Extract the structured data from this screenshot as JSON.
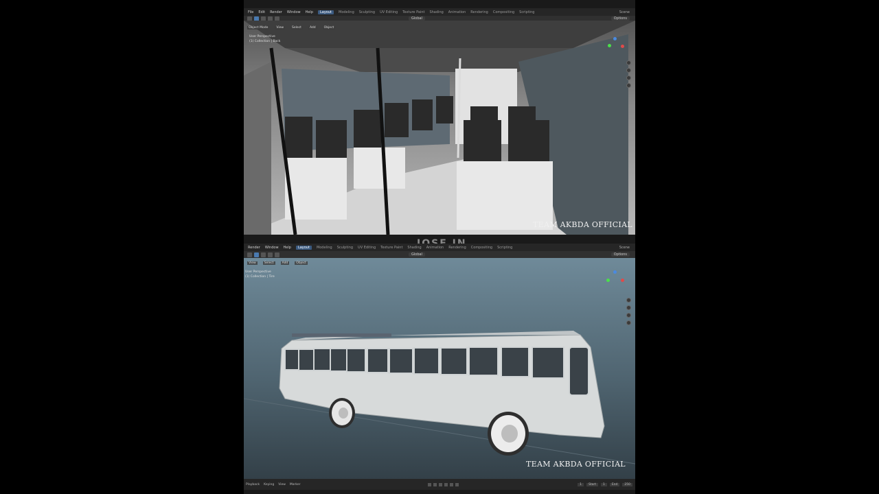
{
  "top_window": {
    "menu": [
      "File",
      "Edit",
      "Render",
      "Window",
      "Help"
    ],
    "workspaces": [
      "Layout",
      "Modeling",
      "Sculpting",
      "UV Editing",
      "Texture Paint",
      "Shading",
      "Animation",
      "Rendering",
      "Compositing",
      "Scripting"
    ],
    "active_workspace": "Layout",
    "scene": "Scene",
    "transform_orientation": "Global",
    "options": "Options",
    "header_menus": [
      "Object Mode",
      "View",
      "Select",
      "Add",
      "Object"
    ],
    "view_info": [
      "User Perspective",
      "(1) Collection | Back"
    ],
    "watermark": "TEAM AKBDA OFFICIAL"
  },
  "bottom_window": {
    "menu": [
      "Render",
      "Window",
      "Help"
    ],
    "workspaces": [
      "Layout",
      "Modeling",
      "Sculpting",
      "UV Editing",
      "Texture Paint",
      "Shading",
      "Animation",
      "Rendering",
      "Compositing",
      "Scripting"
    ],
    "active_workspace": "Layout",
    "scene": "Scene",
    "transform_orientation": "Global",
    "options": "Options",
    "header_menus": [
      "View",
      "Select",
      "Add",
      "Object"
    ],
    "view_info": [
      "User Perspective",
      "(1) Collection | Tire"
    ],
    "watermark": "TEAM AKBDA OFFICIAL",
    "timeline": {
      "left": [
        "Playback",
        "Keying",
        "View",
        "Marker"
      ],
      "start_label": "Start",
      "start": "1",
      "end_label": "End",
      "end": "250",
      "current": "1"
    }
  },
  "overlay_text": "JOSE JN",
  "colors": {
    "active_tab": "#3b5a80",
    "viewport_bg": "#4f6470"
  }
}
